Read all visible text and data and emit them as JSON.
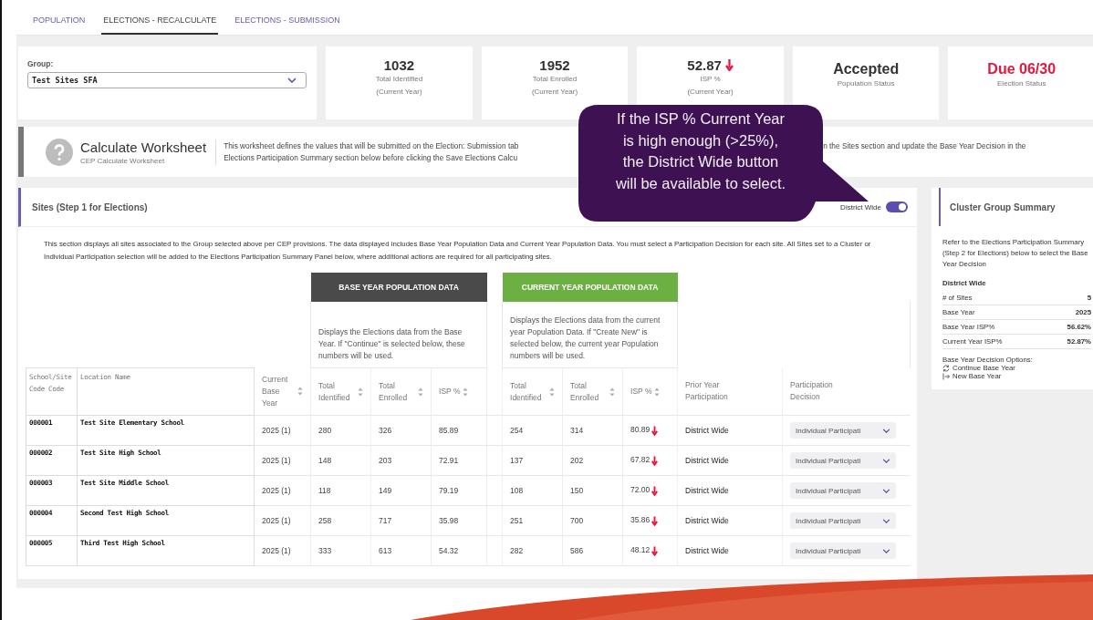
{
  "tabs": [
    {
      "label": "POPULATION",
      "selected": false
    },
    {
      "label": "ELECTIONS - RECALCULATE",
      "selected": true
    },
    {
      "label": "ELECTIONS - SUBMISSION",
      "selected": false
    }
  ],
  "group": {
    "label": "Group:",
    "value": "Test Sites SFA"
  },
  "stats": [
    {
      "value": "1032",
      "label": "Total Identified",
      "sub": "(Current Year)",
      "kind": "number",
      "alert": false,
      "down": false
    },
    {
      "value": "1952",
      "label": "Total Enrolled",
      "sub": "(Current Year)",
      "kind": "number",
      "alert": false,
      "down": false
    },
    {
      "value": "52.87",
      "label": "ISP %",
      "sub": "(Current Year)",
      "kind": "number",
      "alert": false,
      "down": true
    },
    {
      "value": "Accepted",
      "label": "Population Status",
      "kind": "status",
      "alert": false,
      "down": false
    },
    {
      "value": "Due 06/30",
      "label": "Election Status",
      "kind": "status",
      "alert": true,
      "down": false
    }
  ],
  "worksheet": {
    "title": "Calculate Worksheet",
    "subtitle": "CEP Calculate Worksheet",
    "description_left": [
      "This worksheet defines the values that will be submitted on the Election: Submission tab",
      "Elections Participation Summary section below before clicking the Save Elections Calcu"
    ],
    "description_right": "n the Sites section and update the Base Year Decision in the"
  },
  "callout": {
    "text": "If the ISP % Current Year is high enough (>25%), the District Wide button will be available to select."
  },
  "sites": {
    "title": "Sites (Step 1 for Elections)",
    "toggle": {
      "label": "District Wide",
      "on": true
    },
    "intro": "This section displays all sites associated to the Group selected above per CEP provisions. The data displayed includes Base Year Population Data and Current Year Population Data. You must select a Participation Decision for each site. All Sites set to a Cluster or Individual Participation selection will be added to the Elections Participation Summary Panel below, where additional actions are required for all participating sites.",
    "base_header": "BASE YEAR POPULATION DATA",
    "base_note": "Displays the Elections data from the Base Year. If \"Continue\" is selected below, these numbers will be used.",
    "current_header": "CURRENT YEAR POPULATION DATA",
    "current_note": "Displays the Elections data from the current year Population Data. If \"Create New\" is selected below, the current year Population numbers will be used.",
    "columns": [
      {
        "label": "School/Site Code Code",
        "sortable": false
      },
      {
        "label": "Location Name",
        "sortable": false
      },
      {
        "label": "Current Base Year",
        "sortable": true
      },
      {
        "label": "Total Identified",
        "sortable": true
      },
      {
        "label": "Total Enrolled",
        "sortable": true
      },
      {
        "label": "ISP %",
        "sortable": true
      },
      {
        "label": "Total Identified",
        "sortable": true
      },
      {
        "label": "Total Enrolled",
        "sortable": true
      },
      {
        "label": "ISP %",
        "sortable": true
      },
      {
        "label": "Prior Year Participation",
        "sortable": false
      },
      {
        "label": "Participation Decision",
        "sortable": false
      }
    ],
    "rows": [
      {
        "code": "000001",
        "location": "Test Site Elementary School",
        "base_year": "2025 (1)",
        "base_identified": "280",
        "base_enrolled": "326",
        "base_isp": "85.89",
        "cur_identified": "254",
        "cur_enrolled": "314",
        "cur_isp": "80.89",
        "down": true,
        "prior": "District Wide",
        "decision": "Individual Participati"
      },
      {
        "code": "000002",
        "location": "Test Site High School",
        "base_year": "2025 (1)",
        "base_identified": "148",
        "base_enrolled": "203",
        "base_isp": "72.91",
        "cur_identified": "137",
        "cur_enrolled": "202",
        "cur_isp": "67.82",
        "down": true,
        "prior": "District Wide",
        "decision": "Individual Participati"
      },
      {
        "code": "000003",
        "location": "Test Site Middle School",
        "base_year": "2025 (1)",
        "base_identified": "118",
        "base_enrolled": "149",
        "base_isp": "79.19",
        "cur_identified": "108",
        "cur_enrolled": "150",
        "cur_isp": "72.00",
        "down": true,
        "prior": "District Wide",
        "decision": "Individual Participati"
      },
      {
        "code": "000004",
        "location": "Second Test High School",
        "base_year": "2025 (1)",
        "base_identified": "258",
        "base_enrolled": "717",
        "base_isp": "35.98",
        "cur_identified": "251",
        "cur_enrolled": "700",
        "cur_isp": "35.86",
        "down": true,
        "prior": "District Wide",
        "decision": "Individual Participati"
      },
      {
        "code": "000005",
        "location": "Third Test High School",
        "base_year": "2025 (1)",
        "base_identified": "333",
        "base_enrolled": "613",
        "base_isp": "54.32",
        "cur_identified": "282",
        "cur_enrolled": "586",
        "cur_isp": "48.12",
        "down": true,
        "prior": "District Wide",
        "decision": "Individual Participati"
      }
    ]
  },
  "summary": {
    "title": "Cluster Group Summary",
    "intro": "Refer to the Elections Participation Summary (Step 2 for Elections) below to select the Base Year Decision",
    "heading": "District Wide",
    "stats": [
      {
        "label": "# of Sites",
        "value": "5"
      },
      {
        "label": "Base Year",
        "value": "2025"
      },
      {
        "label": "Base Year ISP%",
        "value": "56.62%"
      },
      {
        "label": "Current Year ISP%",
        "value": "52.87%"
      }
    ],
    "options_label": "Base Year Decision Options:",
    "options": [
      {
        "label": "Continue Base Year",
        "kind": "continue"
      },
      {
        "label": "New Base Year",
        "kind": "new"
      }
    ]
  }
}
